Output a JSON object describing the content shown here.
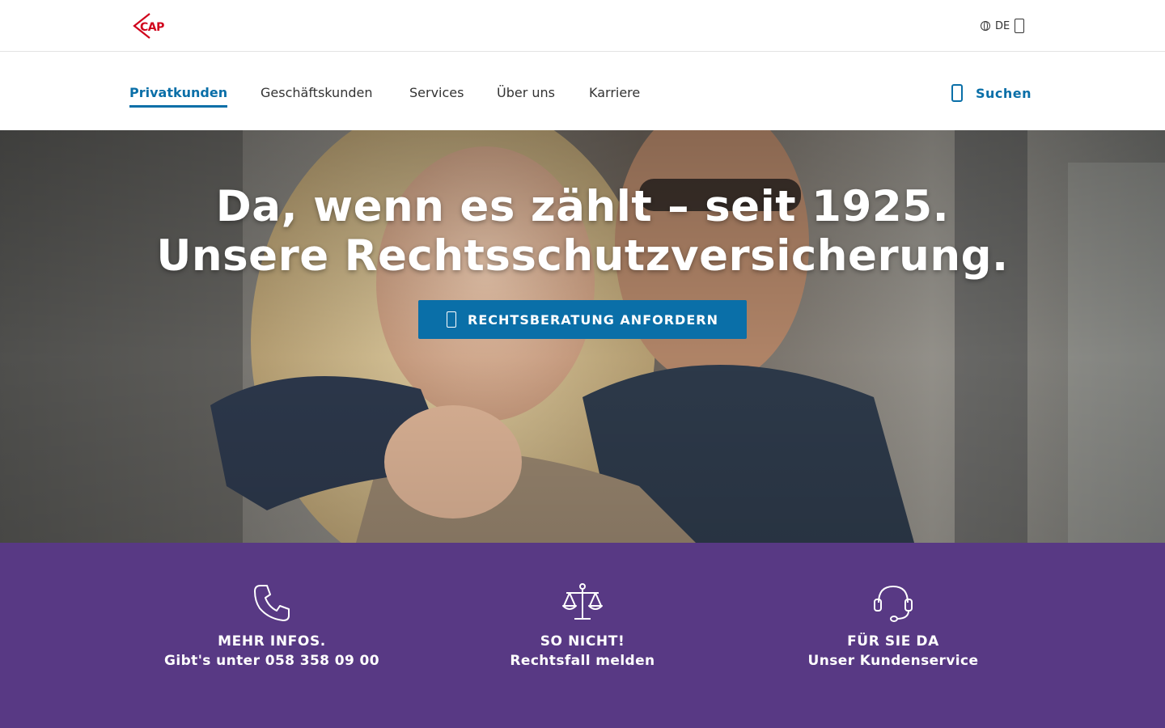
{
  "brand": {
    "logo_text": "CAP",
    "logo_color": "#d0021b"
  },
  "topbar": {
    "language": "DE"
  },
  "nav": {
    "items": [
      {
        "label": "Privatkunden",
        "active": true
      },
      {
        "label": "Geschäftskunden",
        "active": false
      },
      {
        "label": "Services",
        "active": false
      },
      {
        "label": "Über uns",
        "active": false
      },
      {
        "label": "Karriere",
        "active": false
      }
    ],
    "search_label": "Suchen"
  },
  "hero": {
    "title_line1": "Da, wenn es zählt – seit 1925.",
    "title_line2": "Unsere Rechtsschutzversicherung.",
    "cta_label": "RECHTSBERATUNG ANFORDERN"
  },
  "features": [
    {
      "icon": "phone-icon",
      "title": "MEHR INFOS.",
      "subtitle": "Gibt's unter 058 358 09 00"
    },
    {
      "icon": "scales-icon",
      "title": "SO NICHT!",
      "subtitle": "Rechtsfall melden"
    },
    {
      "icon": "headset-icon",
      "title": "FÜR SIE DA",
      "subtitle": "Unser Kundenservice"
    }
  ],
  "colors": {
    "primary": "#0a6fa8",
    "band": "#583984",
    "text": "#333333"
  }
}
